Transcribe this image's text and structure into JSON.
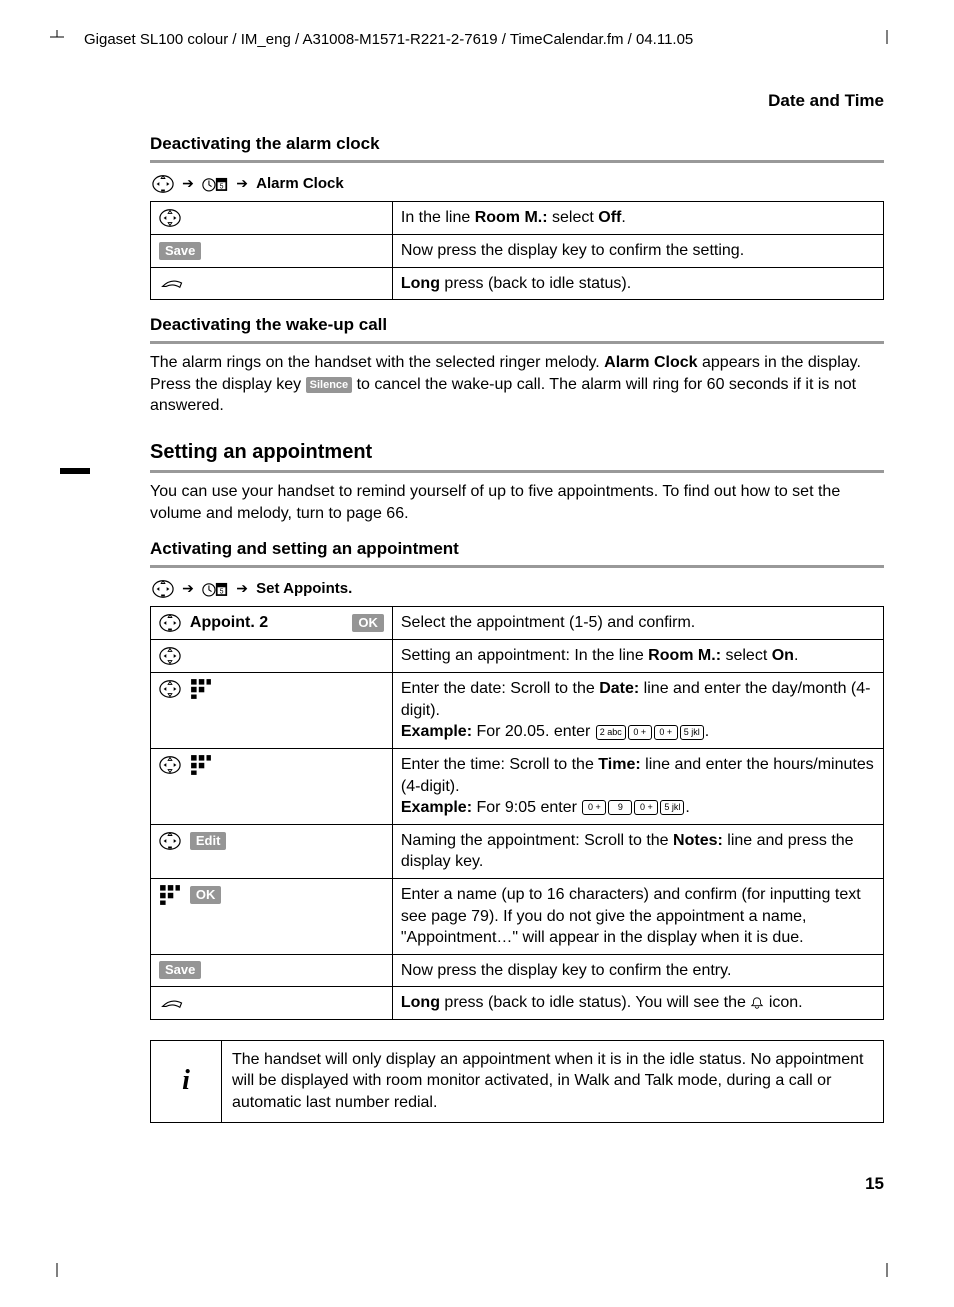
{
  "header": "Gigaset SL100 colour / IM_eng / A31008-M1571-R221-2-7619 / TimeCalendar.fm / 04.11.05",
  "section_title": "Date and Time",
  "h3_1": "Deactivating the alarm clock",
  "nav1_label": "Alarm Clock",
  "table1": {
    "r1": {
      "desc_a": "In the line ",
      "desc_b": "Room M.:",
      "desc_c": " select ",
      "desc_d": "Off",
      "desc_e": "."
    },
    "r2": {
      "btn": "Save",
      "desc": "Now press the display key to confirm the setting."
    },
    "r3": {
      "desc_a": "Long",
      "desc_b": " press (back to idle status)."
    }
  },
  "h3_2": "Deactivating the wake-up call",
  "para1_a": "The alarm rings on the handset with the selected ringer melody. ",
  "para1_b": "Alarm Clock",
  "para1_c": " appears in the display. Press the display key ",
  "para1_btn": "Silence",
  "para1_d": " to cancel the wake-up call. The alarm will ring for 60 seconds if it is not answered.",
  "h2": "Setting an appointment",
  "para2": "You can use your handset to remind yourself of up to five appointments. To find out how to set the volume and melody, turn to page 66.",
  "h3_3": "Activating and setting an appointment",
  "nav2_label": "Set Appoints.",
  "table2": {
    "r1": {
      "label": "Appoint. 2",
      "btn": "OK",
      "desc": "Select the appointment (1-5) and confirm."
    },
    "r2": {
      "a": "Setting an appointment: In the line ",
      "b": "Room M.:",
      "c": " select ",
      "d": "On",
      "e": "."
    },
    "r3": {
      "a": "Enter the date: Scroll to the ",
      "b": "Date:",
      "c": " line and enter the day/month (4-digit).",
      "ex_l": "Example:",
      "ex_t": " For 20.05. enter ",
      "k": [
        "2 abc",
        "0 +",
        "0 +",
        "5 jkl"
      ],
      "ex_end": "."
    },
    "r4": {
      "a": "Enter the time: Scroll to the ",
      "b": "Time:",
      "c": " line and enter the hours/minutes (4-digit).",
      "ex_l": "Example:",
      "ex_t": " For 9:05 enter ",
      "k": [
        "0 +",
        "9",
        "0 +",
        "5 jkl"
      ],
      "ex_end": "."
    },
    "r5": {
      "btn": "Edit",
      "a": "Naming the appointment: Scroll to the ",
      "b": "Notes:",
      "c": " line and press the display key."
    },
    "r6": {
      "btn": "OK",
      "desc": "Enter a name (up to 16 characters) and confirm (for inputting text see page 79). If you do not give the appointment a name, \"Appointment…\" will appear in the display when it is due."
    },
    "r7": {
      "btn": "Save",
      "desc": "Now press the display key to confirm the entry."
    },
    "r8": {
      "a": "Long",
      "b": " press (back to idle status). You will see the ",
      "c": " icon."
    }
  },
  "info": "The handset will only display an appointment when it is in the idle status. No appointment will be displayed with room monitor activated, in Walk and Talk mode, during a call or automatic last number redial.",
  "info_icon": "i",
  "page_number": "15"
}
